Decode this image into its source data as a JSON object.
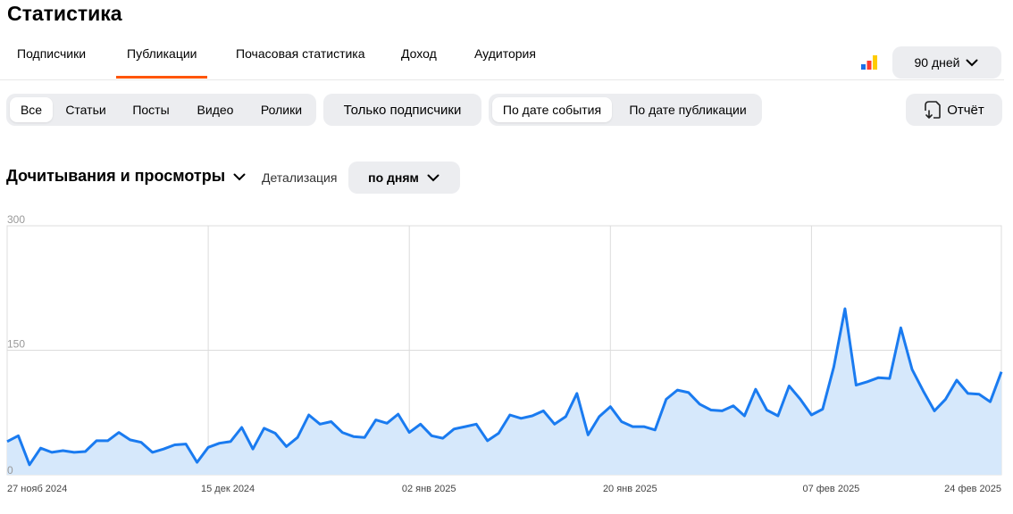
{
  "page": {
    "title": "Статистика"
  },
  "tabs": [
    {
      "label": "Подписчики",
      "active": false
    },
    {
      "label": "Публикации",
      "active": true
    },
    {
      "label": "Почасовая статистика",
      "active": false
    },
    {
      "label": "Доход",
      "active": false
    },
    {
      "label": "Аудитория",
      "active": false
    }
  ],
  "period": {
    "label": "90 дней",
    "icon": "chevron-down-icon"
  },
  "brand_icon": {
    "name": "bar-chart-logo-icon",
    "colors": [
      "#1d6fe8",
      "#ff3b30",
      "#ffcc00"
    ]
  },
  "filters": {
    "content_types": [
      "Все",
      "Статьи",
      "Посты",
      "Видео",
      "Ролики"
    ],
    "content_selected": "Все",
    "subscribers_only": "Только подписчики",
    "date_modes": [
      "По дате события",
      "По дате публикации"
    ],
    "date_selected": "По дате события"
  },
  "report_button": {
    "label": "Отчёт",
    "icon": "report-download-icon"
  },
  "metric_selector": {
    "label": "Дочитывания и просмотры"
  },
  "detail": {
    "label": "Детализация",
    "value": "по дням"
  },
  "colors": {
    "accent": "#ff5500",
    "line": "#1a7bf0",
    "fill": "#d6e8fb",
    "grid": "#dcdcdc"
  },
  "chart_data": {
    "type": "area",
    "ylim": [
      0,
      300
    ],
    "yticks": [
      "0",
      "150",
      "300"
    ],
    "xtick_labels": [
      "27 нояб 2024",
      "15 дек 2024",
      "02 янв 2025",
      "20 янв 2025",
      "07 фев 2025",
      "24 фев 2025"
    ],
    "x_start": "2024-11-27",
    "x_end": "2025-02-24",
    "values": [
      40,
      47,
      12,
      32,
      27,
      29,
      27,
      28,
      41,
      41,
      51,
      42,
      39,
      27,
      31,
      36,
      37,
      15,
      33,
      38,
      40,
      57,
      31,
      56,
      50,
      34,
      45,
      72,
      61,
      64,
      51,
      46,
      45,
      66,
      62,
      73,
      51,
      61,
      47,
      44,
      55,
      58,
      61,
      41,
      50,
      72,
      68,
      71,
      77,
      61,
      70,
      98,
      48,
      70,
      82,
      64,
      58,
      58,
      54,
      91,
      102,
      99,
      85,
      78,
      77,
      83,
      71,
      103,
      78,
      71,
      107,
      91,
      72,
      79,
      130,
      200,
      108,
      112,
      117,
      116,
      177,
      127,
      101,
      77,
      91,
      114,
      98,
      97,
      88,
      124
    ]
  }
}
